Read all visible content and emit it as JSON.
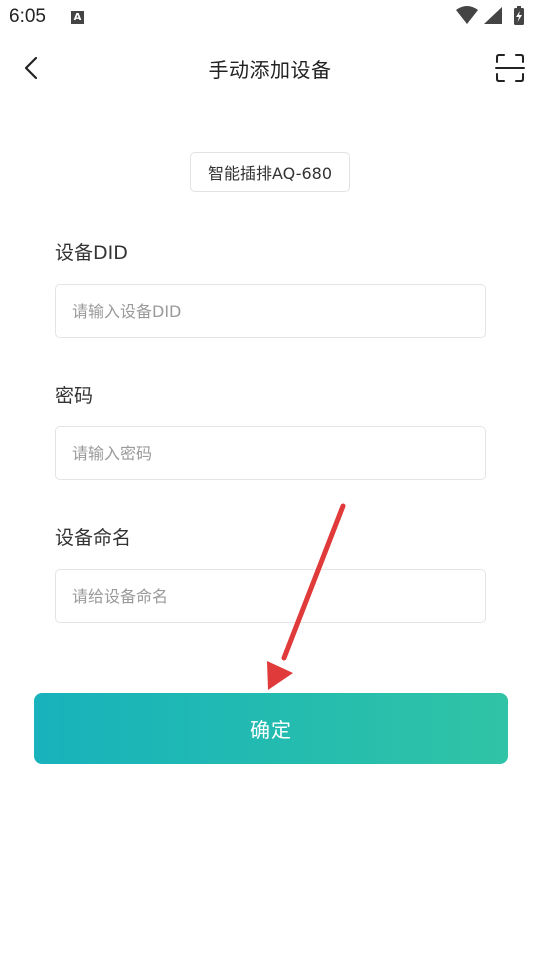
{
  "status_bar": {
    "time": "6:05",
    "indicator": "A",
    "icons": [
      "wifi-icon",
      "signal-icon",
      "battery-charging-icon"
    ]
  },
  "header": {
    "title": "手动添加设备",
    "back_icon": "chevron-left-icon",
    "scan_icon": "scan-icon"
  },
  "device": {
    "name": "智能插排AQ-680"
  },
  "form": {
    "did": {
      "label": "设备DID",
      "placeholder": "请输入设备DID",
      "value": ""
    },
    "password": {
      "label": "密码",
      "placeholder": "请输入密码",
      "value": ""
    },
    "name": {
      "label": "设备命名",
      "placeholder": "请给设备命名",
      "value": ""
    }
  },
  "confirm_button": {
    "label": "确定"
  },
  "colors": {
    "button_gradient_start": "#17b2bc",
    "button_gradient_end": "#30c3a6",
    "annotation_arrow": "#e03a3a"
  }
}
